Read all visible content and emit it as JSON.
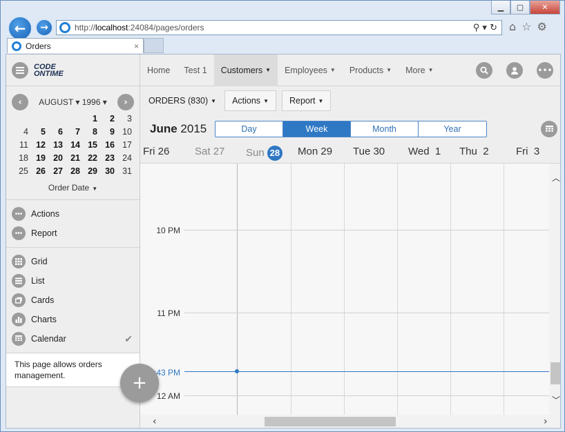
{
  "browser": {
    "url_prefix": "http://",
    "url_host": "localhost",
    "url_rest": ":24084/pages/orders",
    "tab_title": "Orders",
    "tab_close": "×",
    "back_glyph": "←",
    "forward_glyph": "→",
    "addr_tools": "⚲ ▾ ↻",
    "right_tools": [
      "⌂",
      "☆",
      "⚙"
    ],
    "win_min": "▁",
    "win_max": "▢",
    "win_close": "✕"
  },
  "sidebar": {
    "logo_line1": "CODE",
    "logo_line2": "ONTIME",
    "calendar": {
      "month_label": "AUGUST ▾ 1996 ▾",
      "prev_glyph": "‹",
      "next_glyph": "›",
      "weeks": [
        [
          "",
          "",
          "",
          "",
          "1",
          "2",
          "3"
        ],
        [
          "4",
          "5",
          "6",
          "7",
          "8",
          "9",
          "10"
        ],
        [
          "11",
          "12",
          "13",
          "14",
          "15",
          "16",
          "17"
        ],
        [
          "18",
          "19",
          "20",
          "21",
          "22",
          "23",
          "24"
        ],
        [
          "25",
          "26",
          "27",
          "28",
          "29",
          "30",
          "31"
        ]
      ],
      "footer": "Order Date"
    },
    "actions": [
      {
        "label": "Actions",
        "icon": "more-icon"
      },
      {
        "label": "Report",
        "icon": "more-icon"
      }
    ],
    "views": [
      {
        "label": "Grid",
        "icon": "grid-icon"
      },
      {
        "label": "List",
        "icon": "list-icon"
      },
      {
        "label": "Cards",
        "icon": "cards-icon"
      },
      {
        "label": "Charts",
        "icon": "charts-icon"
      },
      {
        "label": "Calendar",
        "icon": "calendar-icon",
        "checked": true
      }
    ],
    "description": "This page allows orders management.",
    "fab_glyph": "+"
  },
  "topnav": {
    "items": [
      {
        "label": "Home",
        "dropdown": false
      },
      {
        "label": "Test 1",
        "dropdown": false
      },
      {
        "label": "Customers",
        "dropdown": true,
        "active": true
      },
      {
        "label": "Employees",
        "dropdown": true
      },
      {
        "label": "Products",
        "dropdown": true
      },
      {
        "label": "More",
        "dropdown": true
      }
    ],
    "right_icons": [
      "search-icon",
      "user-icon",
      "more-icon"
    ]
  },
  "toolbar": {
    "orders_label": "ORDERS (830)",
    "actions_label": "Actions",
    "report_label": "Report"
  },
  "calendar_view": {
    "month": "June",
    "year": "2015",
    "view_buttons": [
      "Day",
      "Week",
      "Month",
      "Year"
    ],
    "selected_view": "Week",
    "days": [
      {
        "name": "Fri",
        "num": "26"
      },
      {
        "name": "Sat",
        "num": "27"
      },
      {
        "name": "Sun",
        "num": "28"
      },
      {
        "name": "Mon",
        "num": "29"
      },
      {
        "name": "Tue",
        "num": "30"
      },
      {
        "name": "Wed",
        "num": "1"
      },
      {
        "name": "Thu",
        "num": "2"
      },
      {
        "name": "Fri",
        "num": "3"
      }
    ],
    "today": "28",
    "time_labels": [
      "10 PM",
      "11 PM",
      "12 AM"
    ],
    "now_label": ":43 PM"
  },
  "colors": {
    "accent": "#2f78c4",
    "icon_gray": "#9b9b9b"
  }
}
